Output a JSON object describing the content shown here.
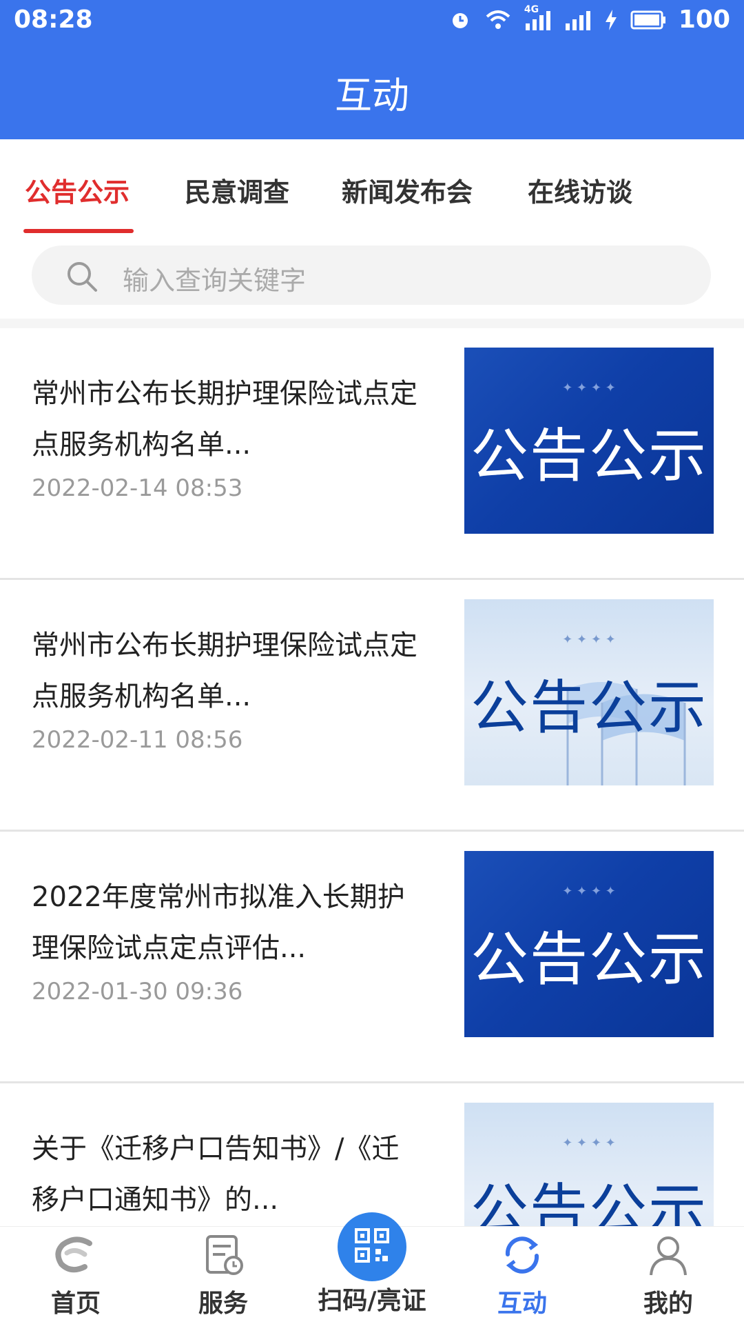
{
  "status_bar": {
    "time": "08:28",
    "network": "4G",
    "battery": "100",
    "icons": [
      "alarm-icon",
      "wifi-icon",
      "signal-4g-icon",
      "signal-icon",
      "charging-icon",
      "battery-icon"
    ]
  },
  "header": {
    "title": "互动"
  },
  "tabs": [
    {
      "label": "公告公示",
      "active": true
    },
    {
      "label": "民意调查",
      "active": false
    },
    {
      "label": "新闻发布会",
      "active": false
    },
    {
      "label": "在线访谈",
      "active": false
    }
  ],
  "search": {
    "placeholder": "输入查询关键字"
  },
  "articles": [
    {
      "title": "常州市公布长期护理保险试点定点服务机构名单...",
      "date": "2022-02-14 08:53",
      "thumb_text": "公告公示",
      "thumb_style": "blue"
    },
    {
      "title": "常州市公布长期护理保险试点定点服务机构名单...",
      "date": "2022-02-11 08:56",
      "thumb_text": "公告公示",
      "thumb_style": "light"
    },
    {
      "title": "2022年度常州市拟准入长期护理保险试点定点评估...",
      "date": "2022-01-30 09:36",
      "thumb_text": "公告公示",
      "thumb_style": "blue"
    },
    {
      "title": "关于《迁移户口告知书》/《迁移户口通知书》的...",
      "date": "",
      "thumb_text": "公告公示",
      "thumb_style": "light"
    }
  ],
  "bottom_nav": [
    {
      "label": "首页",
      "icon": "home-icon",
      "active": false
    },
    {
      "label": "服务",
      "icon": "service-icon",
      "active": false
    },
    {
      "label": "扫码/亮证",
      "icon": "qr-code-icon",
      "active": false
    },
    {
      "label": "互动",
      "icon": "interaction-icon",
      "active": true
    },
    {
      "label": "我的",
      "icon": "profile-icon",
      "active": false
    }
  ],
  "colors": {
    "primary": "#3a74ec",
    "accent_red": "#e02d2d",
    "thumb_blue": "#0f3fa8"
  }
}
